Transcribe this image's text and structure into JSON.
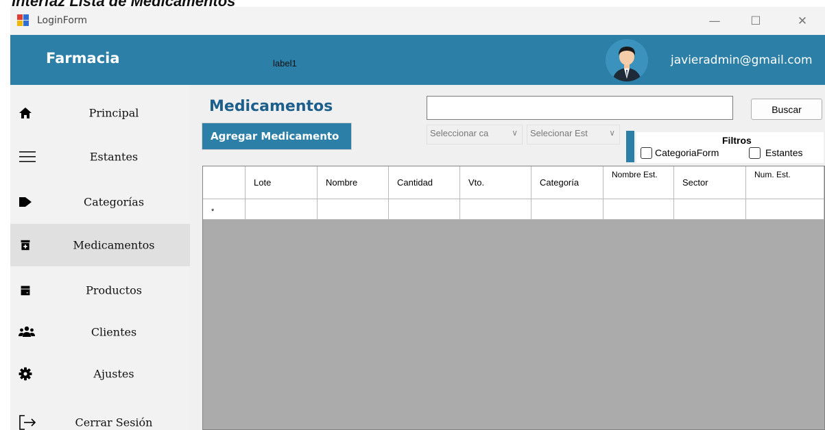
{
  "document_heading": "Interfaz Lista de Medicamentos",
  "window": {
    "title": "LoginForm",
    "controls": {
      "minimize": "—",
      "maximize": "☐",
      "close": "✕"
    }
  },
  "header": {
    "brand": "Farmacia",
    "label": "label1",
    "user_email": "javieradmin@gmail.com",
    "accent_color": "#2c7fa6"
  },
  "sidebar": {
    "items": [
      {
        "label": "Principal",
        "icon": "home-icon"
      },
      {
        "label": "Estantes",
        "icon": "menu-icon"
      },
      {
        "label": "Categorías",
        "icon": "tag-icon"
      },
      {
        "label": "Medicamentos",
        "icon": "medicine-icon",
        "active": true
      },
      {
        "label": "Productos",
        "icon": "product-icon"
      },
      {
        "label": "Clientes",
        "icon": "users-icon"
      },
      {
        "label": "Ajustes",
        "icon": "gear-icon"
      },
      {
        "label": "Cerrar Sesión",
        "icon": "logout-icon"
      }
    ]
  },
  "main": {
    "title": "Medicamentos",
    "add_button": "Agregar Medicamento",
    "search": {
      "value": "",
      "button": "Buscar"
    },
    "category_select": "Seleccionar ca",
    "shelf_select": "Selecionar Est",
    "filters": {
      "title": "Filtros",
      "options": [
        {
          "label": "CategoriaForm",
          "checked": false
        },
        {
          "label": "Estantes",
          "checked": false
        }
      ]
    },
    "table": {
      "columns": [
        "Lote",
        "Nombre",
        "Cantidad",
        "Vto.",
        "Categoría",
        "Nombre Est.",
        "Sector",
        "Num. Est."
      ],
      "new_row_marker": "*",
      "rows": []
    }
  }
}
